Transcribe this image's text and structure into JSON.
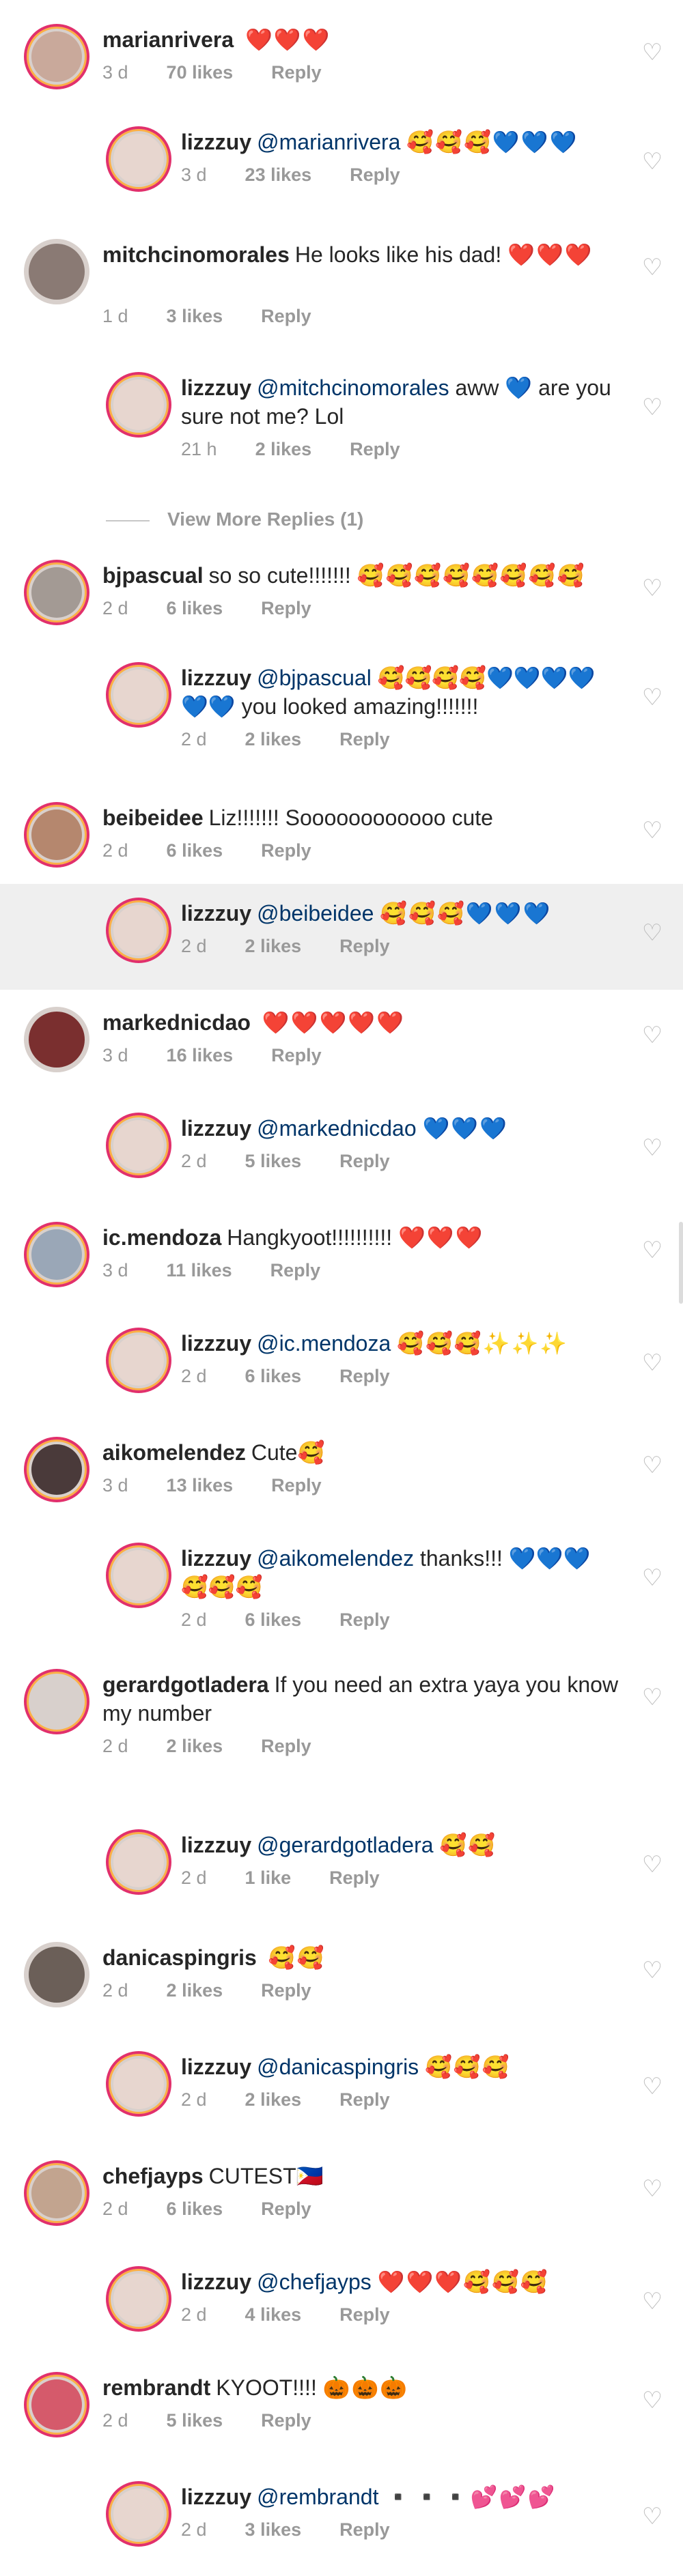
{
  "comments": [
    {
      "user": "marianrivera",
      "text": "",
      "emoji": "❤️❤️❤️",
      "age": "3 d",
      "likes": "70 likes",
      "reply": "Reply"
    },
    {
      "user": "lizzzuy",
      "mention": "@marianrivera",
      "text": "",
      "emoji": "🥰🥰🥰💙💙💙",
      "age": "3 d",
      "likes": "23 likes",
      "reply": "Reply"
    },
    {
      "user": "mitchcinomorales",
      "text": "He looks like his dad!",
      "emoji": "❤️❤️❤️",
      "age": "1 d",
      "likes": "3 likes",
      "reply": "Reply"
    },
    {
      "user": "lizzzuy",
      "mention": "@mitchcinomorales",
      "text": "aww 💙 are you sure not me? Lol",
      "emoji": "",
      "age": "21 h",
      "likes": "2 likes",
      "reply": "Reply"
    },
    {
      "user": "bjpascual",
      "text": "so so cute!!!!!!!",
      "emoji": "🥰🥰🥰🥰🥰🥰🥰🥰",
      "age": "2 d",
      "likes": "6 likes",
      "reply": "Reply"
    },
    {
      "user": "lizzzuy",
      "mention": "@bjpascual",
      "text": "🥰🥰🥰🥰💙💙💙💙💙💙 you looked amazing!!!!!!!",
      "emoji": "",
      "age": "2 d",
      "likes": "2 likes",
      "reply": "Reply"
    },
    {
      "user": "beibeidee",
      "text": "Liz!!!!!!! Soooooooooooo cute",
      "emoji": "",
      "age": "2 d",
      "likes": "6 likes",
      "reply": "Reply"
    },
    {
      "user": "lizzzuy",
      "mention": "@beibeidee",
      "text": "",
      "emoji": "🥰🥰🥰💙💙💙",
      "age": "2 d",
      "likes": "2 likes",
      "reply": "Reply"
    },
    {
      "user": "markednicdao",
      "text": "",
      "emoji": "❤️❤️❤️❤️❤️",
      "age": "3 d",
      "likes": "16 likes",
      "reply": "Reply"
    },
    {
      "user": "lizzzuy",
      "mention": "@markednicdao",
      "text": "",
      "emoji": "💙💙💙",
      "age": "2 d",
      "likes": "5 likes",
      "reply": "Reply"
    },
    {
      "user": "ic.mendoza",
      "text": "Hangkyoot!!!!!!!!!!",
      "emoji": "❤️❤️❤️",
      "age": "3 d",
      "likes": "11 likes",
      "reply": "Reply"
    },
    {
      "user": "lizzzuy",
      "mention": "@ic.mendoza",
      "text": "",
      "emoji": "🥰🥰🥰✨✨✨",
      "age": "2 d",
      "likes": "6 likes",
      "reply": "Reply"
    },
    {
      "user": "aikomelendez",
      "text": "Cute🥰",
      "emoji": "",
      "age": "3 d",
      "likes": "13 likes",
      "reply": "Reply"
    },
    {
      "user": "lizzzuy",
      "mention": "@aikomelendez",
      "text": "thanks!!! 💙💙💙 🥰🥰🥰",
      "emoji": "",
      "age": "2 d",
      "likes": "6 likes",
      "reply": "Reply"
    },
    {
      "user": "gerardgotladera",
      "text": "If you need an extra yaya you know my number",
      "emoji": "",
      "age": "2 d",
      "likes": "2 likes",
      "reply": "Reply"
    },
    {
      "user": "lizzzuy",
      "mention": "@gerardgotladera",
      "text": "",
      "emoji": "🥰🥰",
      "age": "2 d",
      "likes": "1 like",
      "reply": "Reply"
    },
    {
      "user": "danicaspingris",
      "text": "",
      "emoji": "🥰🥰",
      "age": "2 d",
      "likes": "2 likes",
      "reply": "Reply"
    },
    {
      "user": "lizzzuy",
      "mention": "@danicaspingris",
      "text": "",
      "emoji": "🥰🥰🥰",
      "age": "2 d",
      "likes": "2 likes",
      "reply": "Reply"
    },
    {
      "user": "chefjayps",
      "text": "CUTEST🇵🇭",
      "emoji": "",
      "age": "2 d",
      "likes": "6 likes",
      "reply": "Reply"
    },
    {
      "user": "lizzzuy",
      "mention": "@chefjayps",
      "text": "",
      "emoji": "❤️❤️❤️🥰🥰🥰",
      "age": "2 d",
      "likes": "4 likes",
      "reply": "Reply"
    },
    {
      "user": "rembrandt",
      "text": "KYOOT!!!!",
      "emoji": "🎃🎃🎃",
      "age": "2 d",
      "likes": "5 likes",
      "reply": "Reply"
    },
    {
      "user": "lizzzuy",
      "mention": "@rembrandt",
      "text": "",
      "emoji": "▪️▪️▪️💕💕💕",
      "age": "2 d",
      "likes": "3 likes",
      "reply": "Reply"
    }
  ],
  "view_more": "View More Replies (1)",
  "icons": {
    "like": "heart-outline-icon"
  },
  "colors": {
    "mention": "#003569",
    "meta": "#999999",
    "story_ring": "#e1306c",
    "highlight_row": "#efefef"
  }
}
